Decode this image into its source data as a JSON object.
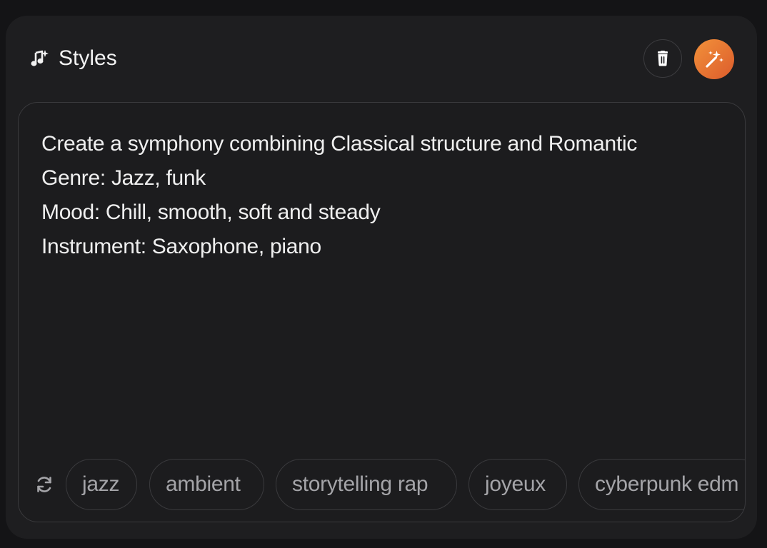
{
  "header": {
    "title": "Styles",
    "title_icon": "music-sparkle-icon",
    "delete_icon": "trash-icon",
    "magic_icon": "magic-wand-icon",
    "accent_color": "#e9783a"
  },
  "prompt": {
    "lines": [
      "Create a symphony combining Classical structure and Romantic",
      "Genre: Jazz, funk",
      "Mood: Chill, smooth, soft and steady",
      "Instrument: Saxophone, piano"
    ]
  },
  "suggestions": {
    "refresh_icon": "refresh-icon",
    "chips": [
      "jazz",
      "ambient",
      "storytelling rap",
      "joyeux",
      "cyberpunk edm"
    ]
  }
}
